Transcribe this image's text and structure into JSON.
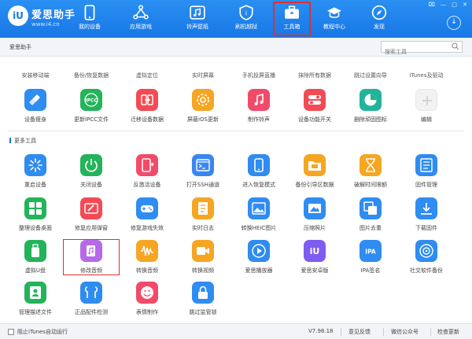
{
  "app": {
    "logo_text": "iU",
    "brand": "爱思助手",
    "url": "www.i4.cn"
  },
  "window_controls": [
    "⌧",
    "—",
    "□",
    "✕"
  ],
  "nav": [
    {
      "label": "我的设备",
      "icon": "phone-icon"
    },
    {
      "label": "应用游戏",
      "icon": "apps-icon"
    },
    {
      "label": "铃声壁纸",
      "icon": "music-icon"
    },
    {
      "label": "刷机越狱",
      "icon": "shield-icon"
    },
    {
      "label": "工具箱",
      "icon": "toolbox-icon",
      "active": true
    },
    {
      "label": "教程中心",
      "icon": "graduation-icon"
    },
    {
      "label": "发现",
      "icon": "compass-icon"
    }
  ],
  "download_icon": "download-icon",
  "subbar": {
    "title": "爱思助手"
  },
  "search": {
    "placeholder": "搜索工具",
    "value": ""
  },
  "top_labels": [
    "安装移动端",
    "备份/恢复数据",
    "虚拟定位",
    "实时屏幕",
    "手机投屏直播",
    "抹除所有数据",
    "跳过设置向导",
    "iTunes及驱动"
  ],
  "row1": [
    {
      "label": "设备瘦身",
      "icon": "broom-icon",
      "color": "#2f8cf0"
    },
    {
      "label": "更新IPCC文件",
      "icon": "ipcc-icon",
      "color": "#23b45a"
    },
    {
      "label": "迁移设备数据",
      "icon": "migrate-icon",
      "color": "#f24b55"
    },
    {
      "label": "屏蔽iOS更新",
      "icon": "gear-icon",
      "color": "#f5a623"
    },
    {
      "label": "制作铃声",
      "icon": "bell-icon",
      "color": "#f24b6a"
    },
    {
      "label": "设备功能开关",
      "icon": "toggle-icon",
      "color": "#f24b55"
    },
    {
      "label": "删除顽固图标",
      "icon": "pie-icon",
      "color": "#22b49a"
    },
    {
      "label": "编辑",
      "icon": "plus-icon",
      "color": "#f2f2f2"
    }
  ],
  "section_more": "更多工具",
  "row2": [
    {
      "label": "重启设备",
      "icon": "loading-icon",
      "color": "#2f8cf0"
    },
    {
      "label": "关闭设备",
      "icon": "power-icon",
      "color": "#23b45a"
    },
    {
      "label": "反激活设备",
      "icon": "deactivate-icon",
      "color": "#f24b6a"
    },
    {
      "label": "打开SSH通道",
      "icon": "terminal-icon",
      "color": "#3a86f0"
    },
    {
      "label": "进入恢复模式",
      "icon": "phone-icon",
      "color": "#2f8cf0"
    },
    {
      "label": "备份引导区数据",
      "icon": "folder-icon",
      "color": "#f5a623"
    },
    {
      "label": "破解时间限额",
      "icon": "hourglass-icon",
      "color": "#f5a623"
    },
    {
      "label": "固件管理",
      "icon": "list-icon",
      "color": "#2f8cf0"
    }
  ],
  "row3": [
    {
      "label": "整理设备桌面",
      "icon": "grid-icon",
      "color": "#23b45a"
    },
    {
      "label": "修复应用弹窗",
      "icon": "repair-icon",
      "color": "#f24b55"
    },
    {
      "label": "修复游戏失效",
      "icon": "gamepad-icon",
      "color": "#2f8cf0"
    },
    {
      "label": "实时日志",
      "icon": "log-icon",
      "color": "#f5a623"
    },
    {
      "label": "转换HEIC图片",
      "icon": "image-icon",
      "color": "#2f8cf0"
    },
    {
      "label": "压缩照片",
      "icon": "photo-icon",
      "color": "#2f8cf0"
    },
    {
      "label": "图片去重",
      "icon": "dedupe-icon",
      "color": "#2f8cf0"
    },
    {
      "label": "下载固件",
      "icon": "download-icon",
      "color": "#2f8cf0"
    }
  ],
  "row4": [
    {
      "label": "虚拟U盘",
      "icon": "usb-icon",
      "color": "#23b45a"
    },
    {
      "label": "修改音频",
      "icon": "audio-edit-icon",
      "color": "#b76ae8",
      "selected": true
    },
    {
      "label": "转换音频",
      "icon": "waveform-icon",
      "color": "#f5a623"
    },
    {
      "label": "转换视频",
      "icon": "video-icon",
      "color": "#f5a623"
    },
    {
      "label": "爱思播放器",
      "icon": "play-icon",
      "color": "#2f8cf0"
    },
    {
      "label": "爱思安卓版",
      "icon": "iu-icon",
      "color": "#7d5cf0"
    },
    {
      "label": "IPA签名",
      "icon": "ipa-icon",
      "color": "#2f8cf0"
    },
    {
      "label": "社交软件备份",
      "icon": "chat-icon",
      "color": "#2f8cf0"
    }
  ],
  "row5": [
    {
      "label": "管理描述文件",
      "icon": "profile-icon",
      "color": "#23b45a"
    },
    {
      "label": "正品配件检测",
      "icon": "earphone-icon",
      "color": "#2f8cf0"
    },
    {
      "label": "表情制作",
      "icon": "emoji-icon",
      "color": "#f24b6a"
    },
    {
      "label": "跳过监管锁",
      "icon": "lock-icon",
      "color": "#2f8cf0"
    }
  ],
  "footer": {
    "checkbox_label": "阻止iTunes自动运行",
    "version": "V7.98.18",
    "feedback": "意见反馈",
    "wechat": "微信公众号",
    "update": "检查更新"
  }
}
